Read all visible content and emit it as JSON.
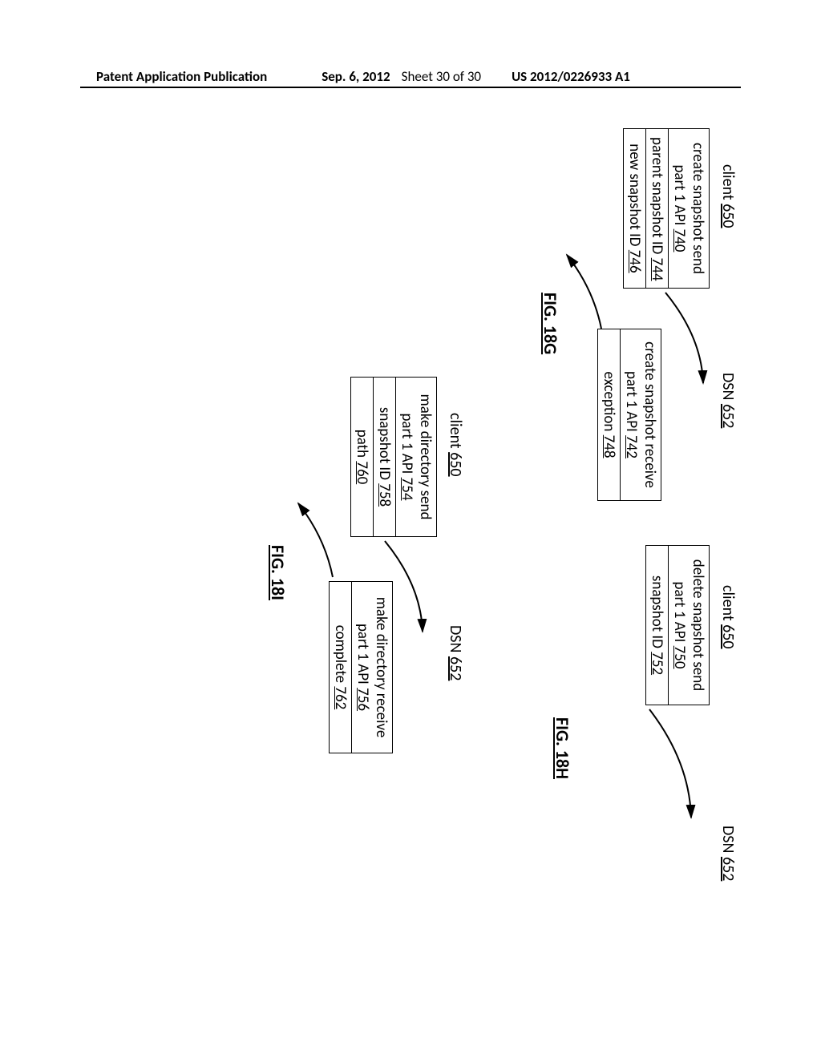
{
  "header": {
    "pub": "Patent Application Publication",
    "date": "Sep. 6, 2012",
    "sheet": "Sheet 30 of 30",
    "docnum": "US 2012/0226933 A1"
  },
  "labels": {
    "client": "client",
    "dsn": "DSN",
    "ref650": "650",
    "ref652": "652"
  },
  "fig18g": {
    "label": "FIG. 18G",
    "sendBox": {
      "line1a": "create snapshot send",
      "line1b_pre": "part 1 API ",
      "line1b_num": "740",
      "line2_pre": "parent snapshot ID ",
      "line2_num": "744",
      "line3_pre": "new snapshot ID ",
      "line3_num": "746"
    },
    "recvBox": {
      "line1a": "create snapshot receive",
      "line1b_pre": "part 1 API ",
      "line1b_num": "742",
      "line2_pre": "exception ",
      "line2_num": "748"
    }
  },
  "fig18h": {
    "label": "FIG. 18H",
    "sendBox": {
      "line1a": "delete snapshot send",
      "line1b_pre": "part 1 API ",
      "line1b_num": "750",
      "line2_pre": "snapshot ID ",
      "line2_num": "752"
    }
  },
  "fig18i": {
    "label": "FIG. 18I",
    "sendBox": {
      "line1a": "make directory send",
      "line1b_pre": "part 1 API ",
      "line1b_num": "754",
      "line2_pre": "snapshot ID ",
      "line2_num": "758",
      "line3_pre": "path ",
      "line3_num": "760"
    },
    "recvBox": {
      "line1a": "make directory receive",
      "line1b_pre": "part 1 API ",
      "line1b_num": "756",
      "line2_pre": "complete ",
      "line2_num": "762"
    }
  }
}
